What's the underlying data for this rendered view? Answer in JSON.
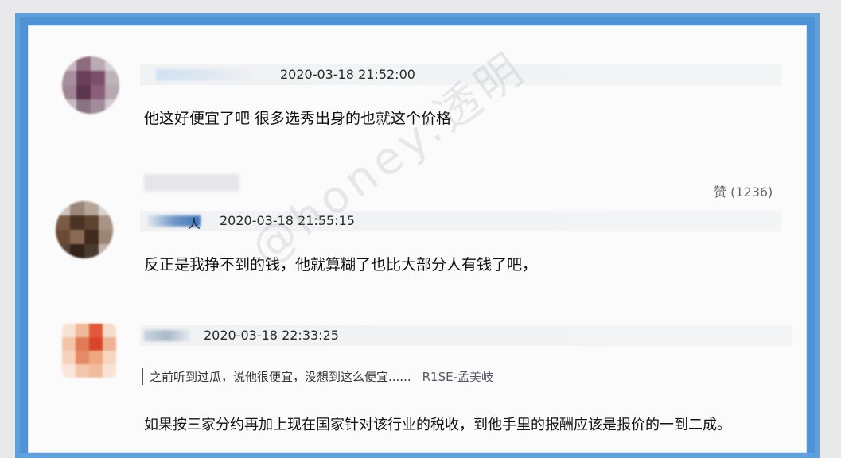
{
  "comments": [
    {
      "timestamp": "2020-03-18 21:52:00",
      "text": "他这好便宜了吧 很多选秀出身的也就这个价格"
    },
    {
      "timestamp": "2020-03-18 21:55:15",
      "name_suffix": "人",
      "text": "反正是我挣不到的钱，他就算糊了也比大部分人有钱了吧，",
      "likes": "赞 (1236)"
    },
    {
      "timestamp": "2020-03-18 22:33:25",
      "quote": "之前听到过瓜，说他很便宜，没想到这么便宜......",
      "quote_author": "R1SE-孟美岐",
      "text": "如果按三家分约再加上现在国家针对该行业的税收，到他手里的报酬应该是报价的一到二成。"
    }
  ],
  "watermark": "@honey:透明"
}
